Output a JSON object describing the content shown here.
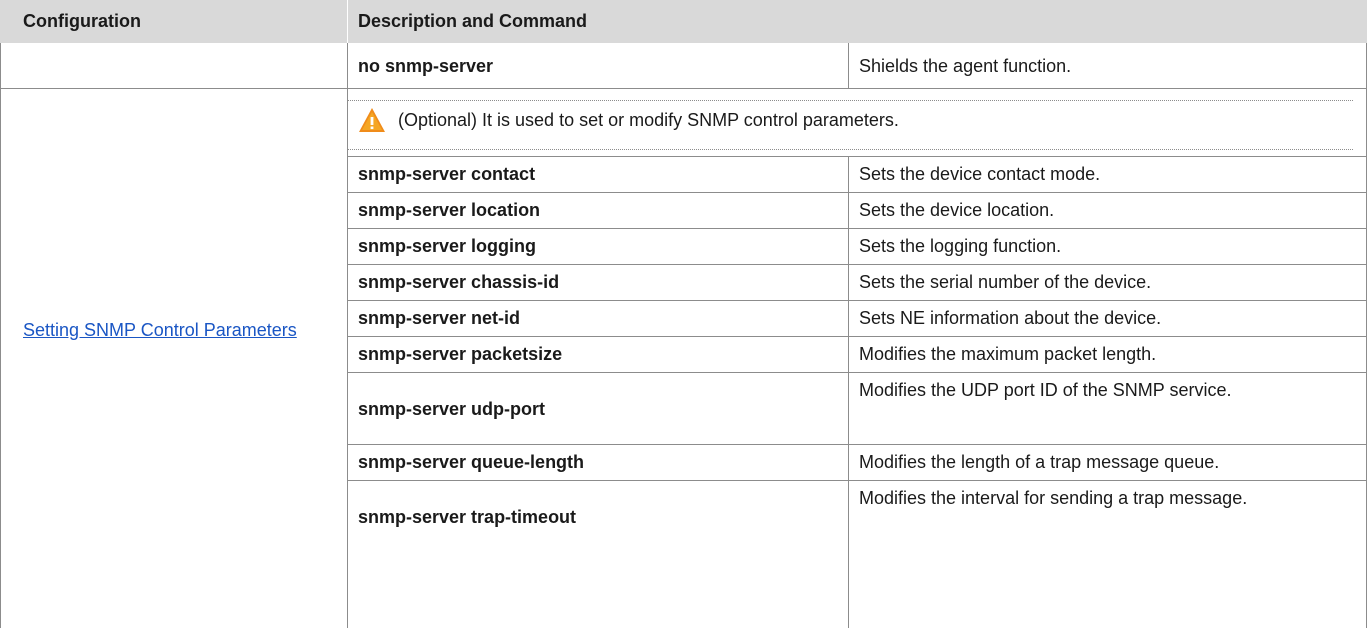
{
  "header": {
    "configuration": "Configuration",
    "description_and_command": "Description and Command"
  },
  "first_row": {
    "command": "no snmp-server",
    "description": "Shields the agent function."
  },
  "section": {
    "link_label": "Setting SNMP Control Parameters",
    "note": "(Optional) It is used to set or modify SNMP control parameters.",
    "warning_icon": "warning-icon"
  },
  "rows": [
    {
      "command": "snmp-server contact",
      "description": "Sets the device contact mode."
    },
    {
      "command": "snmp-server location",
      "description": "Sets the device location."
    },
    {
      "command": "snmp-server logging",
      "description": "Sets the logging function."
    },
    {
      "command": "snmp-server chassis-id",
      "description": "Sets the serial number of the device."
    },
    {
      "command": "snmp-server net-id",
      "description": "Sets NE information about the device."
    },
    {
      "command": "snmp-server packetsize",
      "description": "Modifies the maximum packet length."
    },
    {
      "command": "snmp-server udp-port",
      "description": "Modifies the UDP port ID of the SNMP service."
    },
    {
      "command": "snmp-server queue-length",
      "description": "Modifies the length of a trap message queue."
    },
    {
      "command": "snmp-server trap-timeout",
      "description": "Modifies the interval for sending a trap message."
    }
  ],
  "colors": {
    "header_bg": "#d9d9d9",
    "link": "#1a56c4",
    "warning": "#f08c1a"
  }
}
